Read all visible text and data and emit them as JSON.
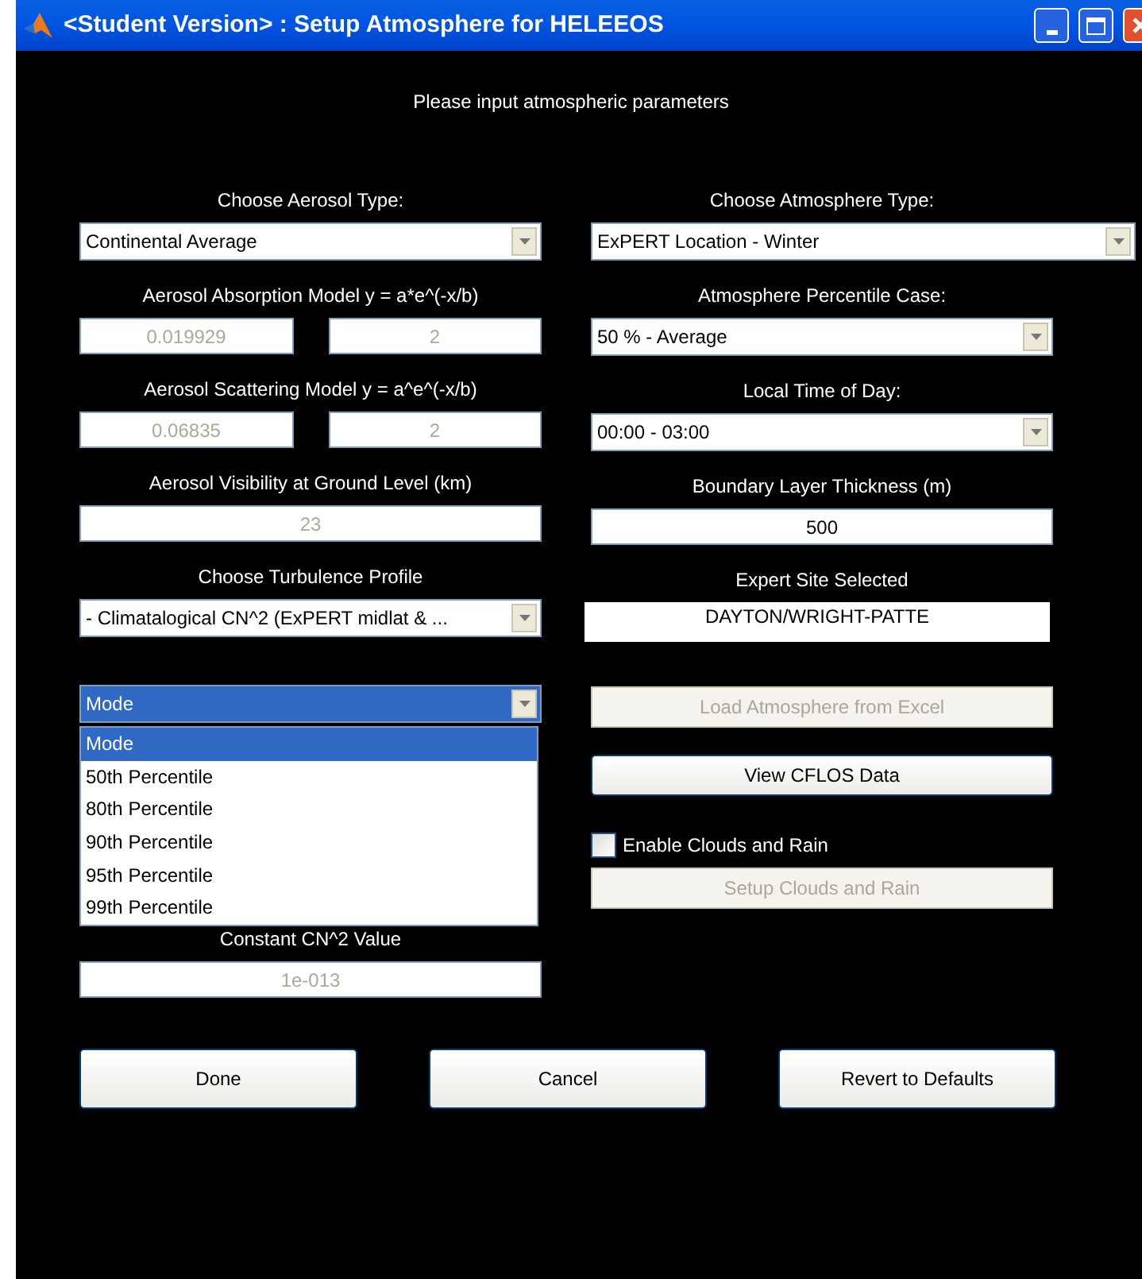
{
  "window": {
    "title": "<Student Version> : Setup Atmosphere for HELEEOS"
  },
  "header": "Please input atmospheric parameters",
  "left_column": [
    {
      "kind": "label",
      "text": "Choose Aerosol Type:"
    },
    {
      "kind": "dropdown",
      "value": "Continental Average"
    },
    {
      "kind": "label",
      "text": "Aerosol Absorption Model y = a*e^(-x/b)"
    },
    {
      "kind": "field_pair",
      "values": [
        "0.019929",
        "2"
      ],
      "disabled": true
    },
    {
      "kind": "label",
      "text": "Aerosol Scattering Model y = a^e^(-x/b)"
    },
    {
      "kind": "field_pair",
      "values": [
        "0.06835",
        "2"
      ],
      "disabled": true
    },
    {
      "kind": "label",
      "text": "Aerosol Visibility at Ground Level (km)"
    },
    {
      "kind": "field",
      "value": "23",
      "disabled": true
    },
    {
      "kind": "label",
      "text": "Choose Turbulence Profile"
    },
    {
      "kind": "dropdown",
      "value": "- Climatalogical CN^2 (ExPERT midlat & ..."
    }
  ],
  "turbulence_mode": {
    "value": "Mode",
    "expanded": true,
    "options": [
      {
        "label": "Mode",
        "selected": true
      },
      {
        "label": "50th Percentile",
        "selected": false
      },
      {
        "label": "80th Percentile",
        "selected": false
      },
      {
        "label": "90th Percentile",
        "selected": false
      },
      {
        "label": "95th Percentile",
        "selected": false
      },
      {
        "label": "99th Percentile",
        "selected": false
      }
    ]
  },
  "constant": {
    "label": "Constant CN^2 Value",
    "value": "1e-013",
    "disabled": true
  },
  "right_column": [
    {
      "kind": "label",
      "text": "Choose Atmosphere Type:"
    },
    {
      "kind": "wide_dropdown",
      "value": "ExPERT Location - Winter"
    },
    {
      "kind": "label",
      "text": "Atmosphere Percentile Case:"
    },
    {
      "kind": "dropdown",
      "value": "50 % - Average"
    },
    {
      "kind": "label",
      "text": "Local Time of Day:"
    },
    {
      "kind": "dropdown",
      "value": "00:00 - 03:00"
    },
    {
      "kind": "label",
      "text": "Boundary Layer Thickness (m)"
    },
    {
      "kind": "field",
      "value": "500",
      "disabled": false
    },
    {
      "kind": "label",
      "text": "Expert Site Selected"
    },
    {
      "kind": "box",
      "value": "DAYTON/WRIGHT-PATTE"
    }
  ],
  "right_actions": [
    {
      "kind": "button",
      "label": "Load Atmosphere from Excel",
      "disabled": true
    },
    {
      "kind": "button",
      "label": "View CFLOS Data",
      "disabled": false
    },
    {
      "kind": "checkbox",
      "label": "Enable Clouds and Rain",
      "checked": false
    },
    {
      "kind": "button",
      "label": "Setup Clouds and Rain",
      "disabled": true
    }
  ],
  "buttons": [
    "Done",
    "Cancel",
    "Revert to Defaults"
  ]
}
